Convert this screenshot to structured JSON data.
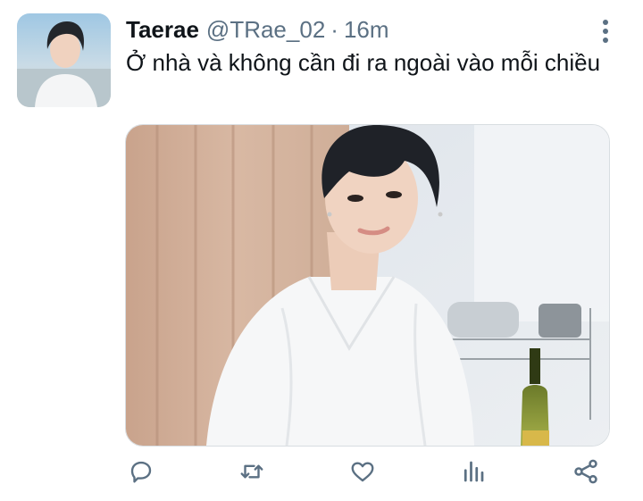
{
  "tweet": {
    "author_name": "Taerae",
    "author_handle": "@TRae_02",
    "separator": "·",
    "time_ago": "16m",
    "text": "Ở nhà và không cần đi ra ngoài vào mỗi chiều"
  },
  "icons": {
    "more": "more-vertical-icon",
    "reply": "reply-icon",
    "retweet": "retweet-icon",
    "like": "heart-icon",
    "analytics": "analytics-icon",
    "share": "share-icon"
  },
  "colors": {
    "primary_text": "#0f1419",
    "secondary_text": "#5b7083",
    "icon": "#5b7083"
  }
}
